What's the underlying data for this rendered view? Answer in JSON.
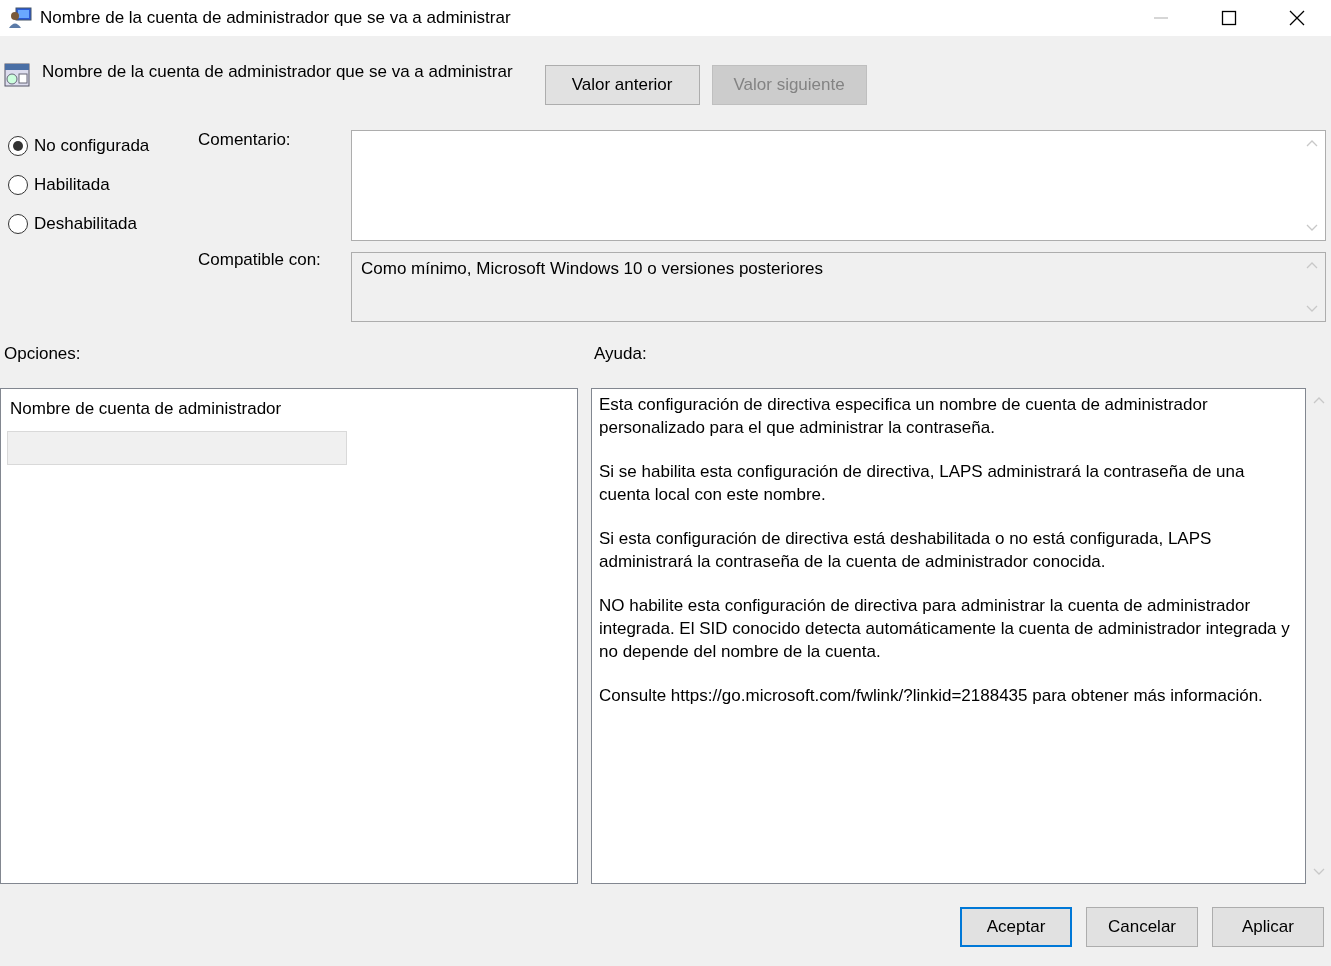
{
  "window": {
    "title": "Nombre de la cuenta de administrador que se va a administrar"
  },
  "header": {
    "title": "Nombre de la cuenta de administrador que se va a administrar",
    "buttons": [
      {
        "label": "Valor anterior",
        "disabled": false
      },
      {
        "label": "Valor siguiente",
        "disabled": true
      }
    ]
  },
  "state_options": [
    {
      "label": "No configurada",
      "selected": true
    },
    {
      "label": "Habilitada",
      "selected": false
    },
    {
      "label": "Deshabilitada",
      "selected": false
    }
  ],
  "comment": {
    "label": "Comentario:"
  },
  "compatible": {
    "label": "Compatible con:",
    "value": "Como mínimo, Microsoft Windows 10 o versiones posteriores"
  },
  "options": {
    "label": "Opciones:",
    "field": {
      "label": "Nombre de cuenta de administrador",
      "disabled": true
    }
  },
  "help": {
    "label": "Ayuda:",
    "paragraphs": [
      "Esta configuración de directiva especifica un nombre de cuenta de administrador personalizado para el que administrar la contraseña.",
      "Si se habilita esta configuración de directiva, LAPS administrará la contraseña de una cuenta local con este nombre.",
      "Si esta configuración de directiva está deshabilitada o no está configurada, LAPS administrará la contraseña de la cuenta de administrador conocida.",
      "NO habilite esta configuración de directiva para administrar la cuenta de administrador integrada. El SID conocido detecta automáticamente la cuenta de administrador integrada y no depende del nombre de la cuenta.",
      "Consulte https://go.microsoft.com/fwlink/?linkid=2188435 para obtener más información."
    ]
  },
  "buttons": [
    {
      "label": "Aceptar",
      "default": true
    },
    {
      "label": "Cancelar",
      "default": false
    },
    {
      "label": "Aplicar",
      "default": false
    }
  ]
}
